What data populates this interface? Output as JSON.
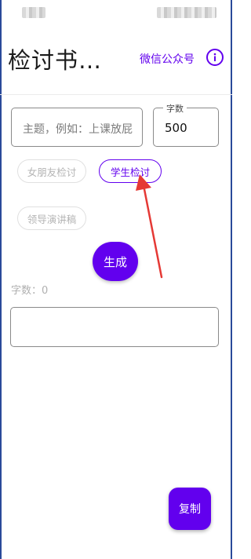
{
  "appbar": {
    "title": "检讨书…",
    "wechat_link": "微信公众号",
    "info_icon": "info-circle-icon"
  },
  "form": {
    "topic_placeholder": "主题，例如：上课放屁",
    "word_count_label": "字数",
    "word_count_value": "500"
  },
  "chips": [
    {
      "label": "女朋友检讨",
      "selected": false
    },
    {
      "label": "学生检讨",
      "selected": true
    },
    {
      "label": "领导演讲稿",
      "selected": false
    }
  ],
  "actions": {
    "generate_label": "生成",
    "copy_label": "复制"
  },
  "result": {
    "count_prefix": "字数：",
    "count_value": "0",
    "output_text": ""
  },
  "colors": {
    "accent": "#6200ee",
    "annotation_arrow": "#e53935"
  }
}
